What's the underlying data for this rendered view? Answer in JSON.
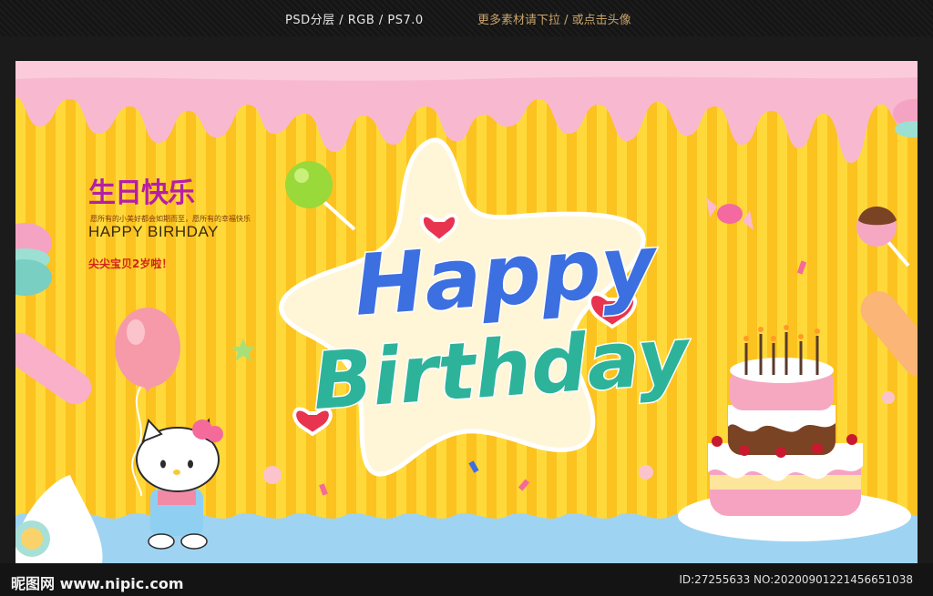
{
  "header": {
    "format_info": "PSD分层 / RGB / PS7.0",
    "hint": "更多素材请下拉 / 或点击头像"
  },
  "poster": {
    "chinese_title": "生日快乐",
    "small_text": "愿所有的小美好都会如期而至，愿所有的幸福快乐",
    "subtitle": "HAPPY BIRHDAY",
    "slogan": "尖尖宝贝2岁啦！",
    "main_line1": "Happy",
    "main_line2": "Birthday"
  },
  "footer": {
    "site": "昵图网 www.nipic.com",
    "id_info": "ID:27255633 NO:20200901221456651038"
  },
  "colors": {
    "stripe_light": "#ffd93a",
    "stripe_dark": "#fcc21f",
    "icing_pink": "#f8b8cf",
    "happy_blue": "#3c6fe0",
    "birthday_teal": "#2db39a",
    "heart_red": "#e8344f"
  }
}
